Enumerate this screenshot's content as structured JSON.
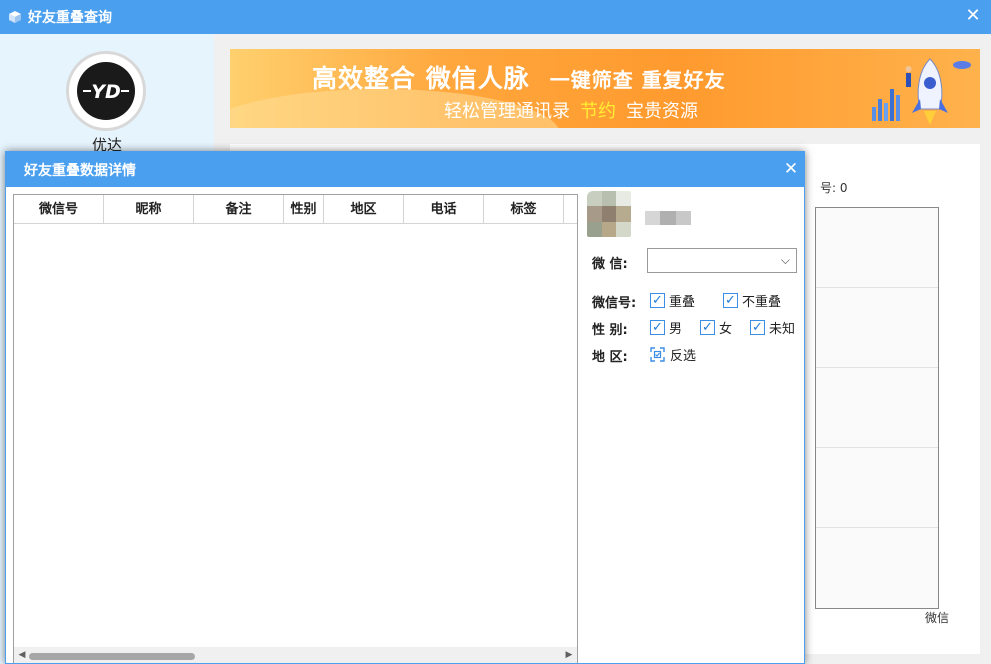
{
  "main_window": {
    "title": "好友重叠查询",
    "close_symbol": "✕"
  },
  "sidebar": {
    "avatar_text": "YD",
    "username": "优达"
  },
  "banner": {
    "headline": "高效整合 微信人脉",
    "headline_sub": "一键筛查 重复好友",
    "tagline_before": "轻松管理通讯录",
    "tagline_highlight": "节约",
    "tagline_after": "宝贵资源",
    "colors": {
      "bg": "#ff9a2e",
      "highlight": "#ffee33"
    }
  },
  "background_panel": {
    "count_text": "号: 0",
    "wechat_label": "微信"
  },
  "dialog": {
    "title": "好友重叠数据详情",
    "close_symbol": "✕",
    "grid": {
      "columns": [
        "微信号",
        "昵称",
        "备注",
        "性别",
        "地区",
        "电话",
        "标签"
      ],
      "rows": []
    },
    "filter": {
      "wechat_label": "微    信:",
      "wechat_value": "",
      "wechat_id_label": "微信号:",
      "gender_label": "性    别:",
      "region_label": "地    区:",
      "options": {
        "overlap": "重叠",
        "not_overlap": "不重叠",
        "male": "男",
        "female": "女",
        "unknown": "未知",
        "invert": "反选"
      },
      "checked": {
        "overlap": true,
        "not_overlap": true,
        "male": true,
        "female": true,
        "unknown": true
      }
    }
  },
  "colors": {
    "titlebar": "#4a9fef",
    "sidebar_bg": "#e6f4fe",
    "checkbox_accent": "#1e7ad8"
  }
}
